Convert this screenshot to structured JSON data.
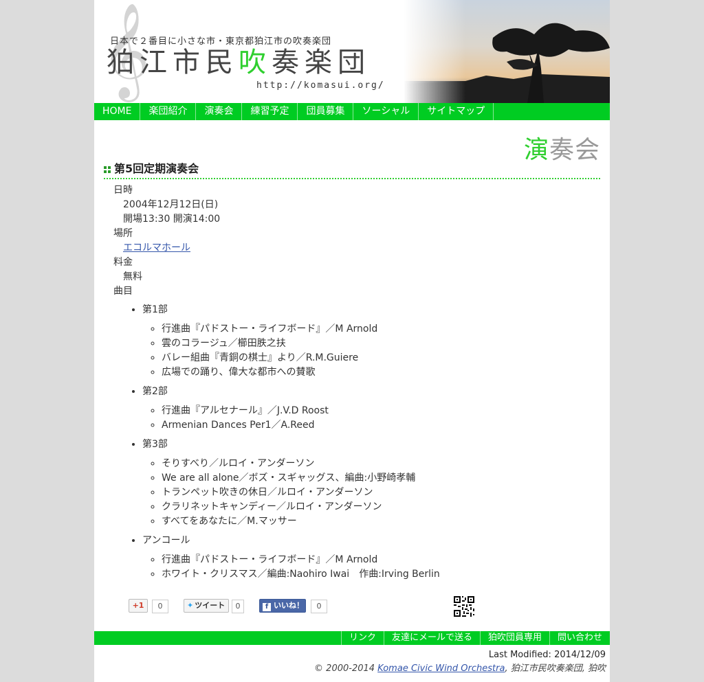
{
  "header": {
    "tagline": "日本で２番目に小さな市・東京都狛江市の吹奏楽団",
    "title_pre": "狛江市民",
    "title_accent": "吹",
    "title_post": "奏楽団",
    "url": "http://komasui.org/"
  },
  "nav": {
    "items": [
      "HOME",
      "楽団紹介",
      "演奏会",
      "練習予定",
      "団員募集",
      "ソーシャル",
      "サイトマップ"
    ]
  },
  "page": {
    "heading_accent": "演",
    "heading_rest": "奏会"
  },
  "concert": {
    "title": "第5回定期演奏会",
    "date_label": "日時",
    "date": "2004年12月12日(日)",
    "time": "開場13:30 開演14:00",
    "venue_label": "場所",
    "venue": "エコルマホール",
    "fee_label": "料金",
    "fee": "無料",
    "program_label": "曲目",
    "parts": [
      {
        "name": "第1部",
        "pieces": [
          "行進曲『パドストー・ライフボード』／M Arnold",
          "雲のコラージュ／櫛田胅之扶",
          "バレー組曲『青銅の棋士』より／R.M.Guiere",
          "広場での踊り、偉大な都市への賛歌"
        ]
      },
      {
        "name": "第2部",
        "pieces": [
          "行進曲『アルセナール』／J.V.D Roost",
          "Armenian Dances Per1／A.Reed"
        ]
      },
      {
        "name": "第3部",
        "pieces": [
          "そりすべり／ルロイ・アンダーソン",
          "We are all alone／ボズ・スギャッグス、編曲:小野崎孝輔",
          "トランペット吹きの休日／ルロイ・アンダーソン",
          "クラリネットキャンディー／ルロイ・アンダーソン",
          "すべてをあなたに／M.マッサー"
        ]
      },
      {
        "name": "アンコール",
        "pieces": [
          "行進曲『パドストー・ライフボード』／M Arnold",
          "ホワイト・クリスマス／編曲:Naohiro Iwai　作曲:Irving Berlin"
        ]
      }
    ]
  },
  "social": {
    "gplus_label": "+1",
    "gplus_count": "0",
    "tweet_label": "ツイート",
    "tweet_count": "0",
    "like_label": "いいね！",
    "like_count": "0"
  },
  "footer": {
    "links": [
      "リンク",
      "友達にメールで送る",
      "狛吹団員専用",
      "問い合わせ"
    ],
    "last_modified": "Last Modified: 2014/12/09",
    "copyright_prefix": "© 2000-2014 ",
    "copyright_link": "Komae Civic Wind Orchestra",
    "copyright_suffix": ", 狛江市民吹奏楽団, 狛吹"
  },
  "colors": {
    "accent": "#00cc22",
    "link": "#3355aa"
  }
}
